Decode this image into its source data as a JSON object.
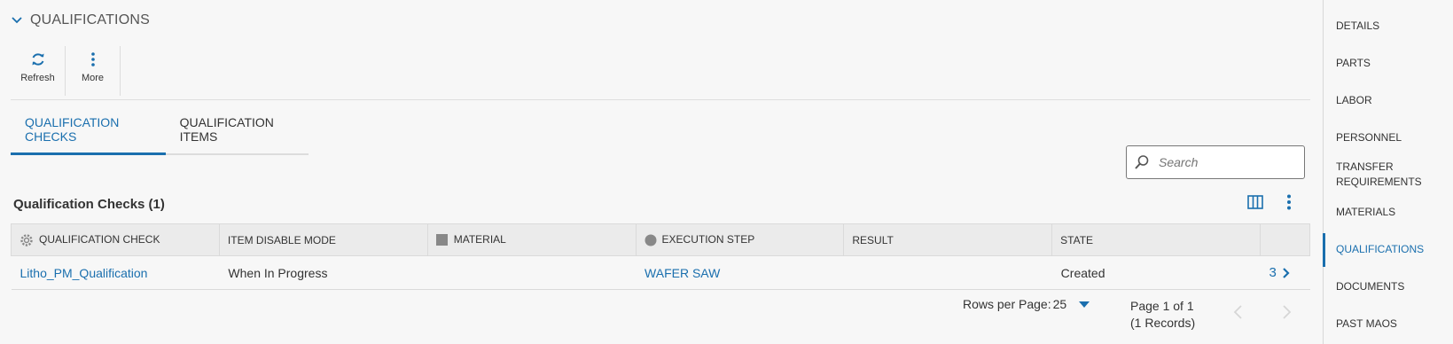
{
  "section": {
    "title": "QUALIFICATIONS"
  },
  "toolbar": {
    "refresh_label": "Refresh",
    "more_label": "More"
  },
  "tabs": [
    {
      "label": "QUALIFICATION CHECKS",
      "active": true
    },
    {
      "label": "QUALIFICATION ITEMS",
      "active": false
    }
  ],
  "search": {
    "placeholder": "Search",
    "value": ""
  },
  "grid": {
    "title": "Qualification Checks (1)",
    "columns": [
      "QUALIFICATION CHECK",
      "ITEM DISABLE MODE",
      "MATERIAL",
      "EXECUTION STEP",
      "RESULT",
      "STATE",
      ""
    ],
    "rows": [
      {
        "check": "Litho_PM_Qualification",
        "disable_mode": "When In Progress",
        "material": "",
        "step": "WAFER SAW",
        "result": "",
        "state": "Created",
        "count": "3"
      }
    ]
  },
  "pagination": {
    "rows_label": "Rows per Page:",
    "rows_value": "25",
    "page": "Page 1 of 1",
    "records": "(1 Records)"
  },
  "side_nav": [
    {
      "label": "DETAILS"
    },
    {
      "label": "PARTS"
    },
    {
      "label": "LABOR"
    },
    {
      "label": "PERSONNEL"
    },
    {
      "label": "TRANSFER REQUIREMENTS"
    },
    {
      "label": "MATERIALS"
    },
    {
      "label": "QUALIFICATIONS",
      "active": true
    },
    {
      "label": "DOCUMENTS"
    },
    {
      "label": "PAST MAOS"
    }
  ],
  "colors": {
    "accent": "#1a6fae",
    "text": "#333333",
    "header_bg": "#ebebeb",
    "background": "#f7f7f7"
  }
}
